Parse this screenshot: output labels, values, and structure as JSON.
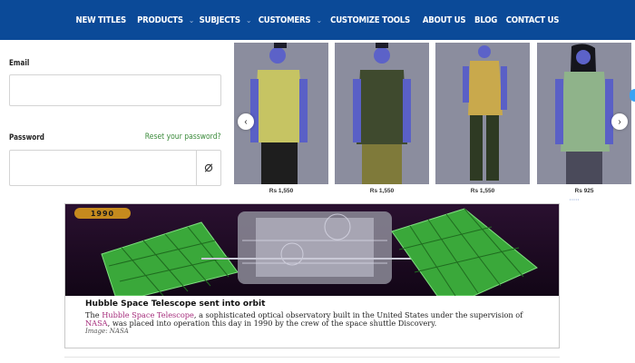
{
  "nav": {
    "items": [
      "NEW TITLES",
      "PRODUCTS",
      "SUBJECTS",
      "CUSTOMERS",
      "CUSTOMIZE TOOLS",
      "ABOUT US",
      "BLOG",
      "CONTACT US"
    ],
    "accent": "#0b4a98"
  },
  "login": {
    "email_label": "Email",
    "email_value": "",
    "password_label": "Password",
    "password_value": "",
    "reset_link": "Reset your password?",
    "toggle_icon": "eye-slash-icon"
  },
  "carousel": {
    "prev_icon": "chevron-left-icon",
    "next_icon": "chevron-right-icon",
    "products": [
      {
        "price": "Rs 1,550",
        "shirt": "#c6c463",
        "pants": "#1e1e1e"
      },
      {
        "price": "Rs 1,550",
        "shirt": "#3f4a2e",
        "pants": "#7f7a3a"
      },
      {
        "price": "Rs 1,550",
        "shirt": "#c9a94c",
        "pants": "#2e3a23"
      },
      {
        "price": "Rs 925",
        "shirt": "#8fb38a",
        "pants": "#4a4a5a"
      }
    ]
  },
  "news": {
    "badge": "1990",
    "title": "Hubble Space Telescope sent into orbit",
    "body_pre": "The ",
    "body_link1": "Hubble Space Telescope",
    "body_mid": ", a sophisticated optical observatory built in the United States under the supervision of ",
    "body_link2": "NASA",
    "body_post": ", was placed into operation this day in 1990 by the crew of the space shuttle Discovery.",
    "credit": "Image: NASA"
  }
}
